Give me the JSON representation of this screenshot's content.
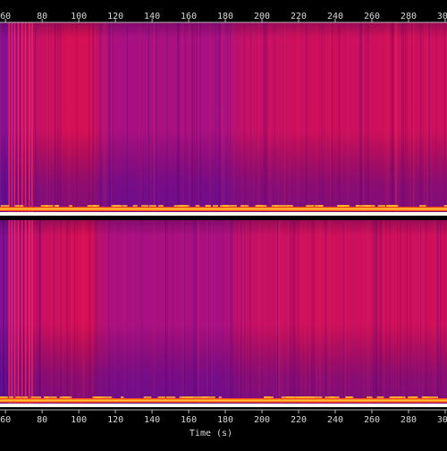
{
  "chart_data": {
    "type": "heatmap",
    "title": "",
    "xlabel": "Time (s)",
    "ylabel": "",
    "xlim": [
      57,
      301
    ],
    "x_ticks": [
      60,
      80,
      100,
      120,
      140,
      160,
      180,
      200,
      220,
      240,
      260,
      280,
      300
    ],
    "tick_label_positions": [
      "top",
      "bottom"
    ],
    "grid": false,
    "legend": "none",
    "channels": [
      "upper",
      "lower"
    ],
    "colormap": [
      "#000000",
      "#1e0050",
      "#5a10a0",
      "#a0108a",
      "#e0104a",
      "#ff5a1e",
      "#ffc832",
      "#fffff0"
    ],
    "background_color": "#000000",
    "energy_profile": {
      "description": "relative spectral energy over time, shared by both channels (0 = dark purple, 1 = bright red)",
      "x": [
        57,
        60,
        62,
        64,
        66,
        68,
        70,
        72,
        74,
        76,
        78,
        80,
        90,
        100,
        108,
        112,
        116,
        120,
        130,
        140,
        150,
        160,
        170,
        180,
        186,
        190,
        200,
        210,
        220,
        230,
        240,
        250,
        260,
        270,
        280,
        290,
        300,
        301
      ],
      "level": [
        0.3,
        0.32,
        0.34,
        0.45,
        0.55,
        0.62,
        0.66,
        0.7,
        0.74,
        0.78,
        0.8,
        0.82,
        0.88,
        0.92,
        0.9,
        0.7,
        0.62,
        0.58,
        0.56,
        0.57,
        0.58,
        0.58,
        0.57,
        0.56,
        0.72,
        0.78,
        0.8,
        0.82,
        0.85,
        0.86,
        0.87,
        0.84,
        0.86,
        0.88,
        0.87,
        0.86,
        0.84,
        0.84
      ]
    },
    "transient_lines_x": [
      62,
      63.5,
      65,
      67,
      69,
      71,
      73,
      74.5
    ]
  }
}
